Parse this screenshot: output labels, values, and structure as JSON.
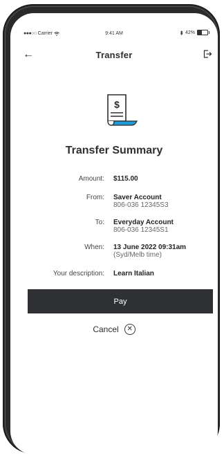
{
  "status_bar": {
    "carrier_dots": "●●●○○",
    "carrier": "Carrier",
    "wifi_icon": "wifi-icon",
    "time": "9:41 AM",
    "bluetooth_icon": "bluetooth-icon",
    "battery_percent": "42%",
    "battery_level": 0.42
  },
  "header": {
    "back_icon": "arrow-left-icon",
    "back_glyph": "←",
    "title": "Transfer",
    "logout_icon": "logout-icon"
  },
  "summary": {
    "icon": "receipt-dollar-icon",
    "icon_accent": "#1e9ad6",
    "title": "Transfer Summary",
    "amount_label": "Amount:",
    "amount": "$115.00",
    "from_label": "From:",
    "from_name": "Saver Account",
    "from_number": "806-036 12345S3",
    "to_label": "To:",
    "to_name": "Everyday Account",
    "to_number": "806-036 12345S1",
    "when_label": "When:",
    "when_date": "13 June 2022 09:31am",
    "when_tz": "(Syd/Melb time)",
    "desc_label": "Your description:",
    "description": "Learn Italian"
  },
  "actions": {
    "pay_label": "Pay",
    "cancel_label": "Cancel",
    "cancel_icon": "close-circle-icon",
    "cancel_glyph": "✕"
  },
  "colors": {
    "pay_button_bg": "#2e3033",
    "frame": "#2a2a2a"
  }
}
